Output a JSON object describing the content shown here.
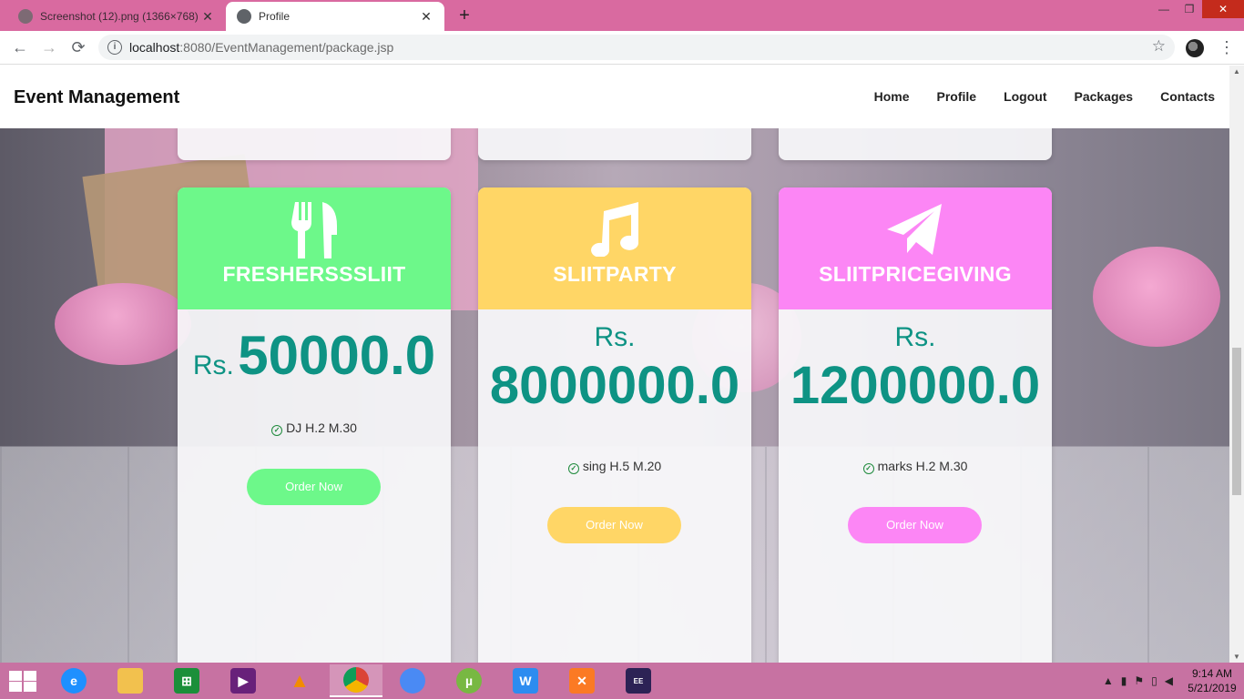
{
  "browser": {
    "tabs": [
      {
        "title": "Screenshot (12).png (1366×768)",
        "close": "✕"
      },
      {
        "title": "Profile",
        "close": "✕"
      }
    ],
    "new_tab": "+",
    "window_controls": {
      "minimize": "—",
      "restore": "❐",
      "close": "✕"
    },
    "nav": {
      "back": "←",
      "forward": "→",
      "reload": "⟳"
    },
    "url_host": "localhost",
    "url_path": ":8080/EventManagement/package.jsp",
    "star": "☆",
    "menu": "⋮"
  },
  "site": {
    "brand": "Event Management",
    "nav": [
      "Home",
      "Profile",
      "Logout",
      "Packages",
      "Contacts"
    ]
  },
  "packages": [
    {
      "name": "FRESHERSSSLIIT",
      "currency": "Rs.",
      "price": "50000.0",
      "feature": "DJ H.2 M.30",
      "button": "Order Now",
      "color": "#6df88a",
      "icon": "fork-knife-icon"
    },
    {
      "name": "SLIITPARTY",
      "currency": "Rs.",
      "price": "8000000.0",
      "feature": "sing H.5 M.20",
      "button": "Order Now",
      "color": "#ffd666",
      "icon": "music-note-icon"
    },
    {
      "name": "SLIITPRICEGIVING",
      "currency": "Rs.",
      "price": "1200000.0",
      "feature": "marks H.2 M.30",
      "button": "Order Now",
      "color": "#fc86f5",
      "icon": "paper-plane-icon"
    }
  ],
  "accent_color": "#0e9384",
  "taskbar": {
    "apps": [
      "internet-explorer",
      "file-explorer",
      "store",
      "visual-studio",
      "vlc",
      "chrome",
      "chrome-canary",
      "utorrent",
      "wps",
      "xampp",
      "java-ee-ide"
    ],
    "time": "9:14 AM",
    "date": "5/21/2019"
  }
}
